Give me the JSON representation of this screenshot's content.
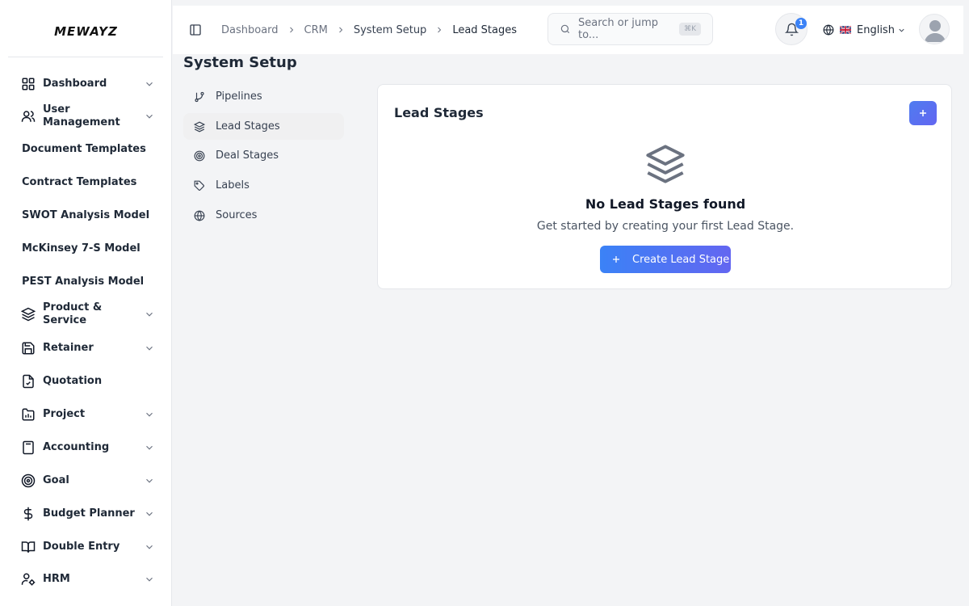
{
  "app": {
    "logo": "MEWAYZ"
  },
  "sidebar": {
    "items": [
      {
        "label": "Dashboard",
        "icon": "grid-icon",
        "chevron": true
      },
      {
        "label": "User Management",
        "icon": "users-icon",
        "chevron": true
      },
      {
        "label": "Document Templates",
        "icon": "",
        "chevron": false
      },
      {
        "label": "Contract Templates",
        "icon": "",
        "chevron": false
      },
      {
        "label": "SWOT Analysis Model",
        "icon": "",
        "chevron": false
      },
      {
        "label": "McKinsey 7-S Model",
        "icon": "",
        "chevron": false
      },
      {
        "label": "PEST Analysis Model",
        "icon": "",
        "chevron": false
      },
      {
        "label": "Product & Service",
        "icon": "layers-icon",
        "chevron": true
      },
      {
        "label": "Retainer",
        "icon": "save-icon",
        "chevron": true
      },
      {
        "label": "Quotation",
        "icon": "file-check-icon",
        "chevron": false
      },
      {
        "label": "Project",
        "icon": "folder-chart-icon",
        "chevron": true
      },
      {
        "label": "Accounting",
        "icon": "calculator-icon",
        "chevron": true
      },
      {
        "label": "Goal",
        "icon": "target-icon",
        "chevron": true
      },
      {
        "label": "Budget Planner",
        "icon": "dollar-icon",
        "chevron": true
      },
      {
        "label": "Double Entry",
        "icon": "book-icon",
        "chevron": true
      },
      {
        "label": "HRM",
        "icon": "user-cog-icon",
        "chevron": true
      }
    ]
  },
  "header": {
    "breadcrumb": [
      "Dashboard",
      "CRM",
      "System Setup",
      "Lead Stages"
    ],
    "search_placeholder": "Search or jump to...",
    "search_shortcut": "⌘K",
    "notification_count": "1",
    "language": "English"
  },
  "main": {
    "title": "System Setup",
    "subnav": [
      {
        "label": "Pipelines",
        "icon": "git-branch-icon",
        "active": false
      },
      {
        "label": "Lead Stages",
        "icon": "layers-icon",
        "active": true
      },
      {
        "label": "Deal Stages",
        "icon": "target-icon",
        "active": false
      },
      {
        "label": "Labels",
        "icon": "tag-icon",
        "active": false
      },
      {
        "label": "Sources",
        "icon": "globe-icon",
        "active": false
      }
    ],
    "card": {
      "title": "Lead Stages",
      "empty_title": "No Lead Stages found",
      "empty_subtitle": "Get started by creating your first Lead Stage.",
      "create_label": "Create Lead Stage"
    }
  },
  "colors": {
    "accent": "#3b82f6",
    "accent_end": "#6366f1",
    "active_bg": "#f0f0f1"
  }
}
